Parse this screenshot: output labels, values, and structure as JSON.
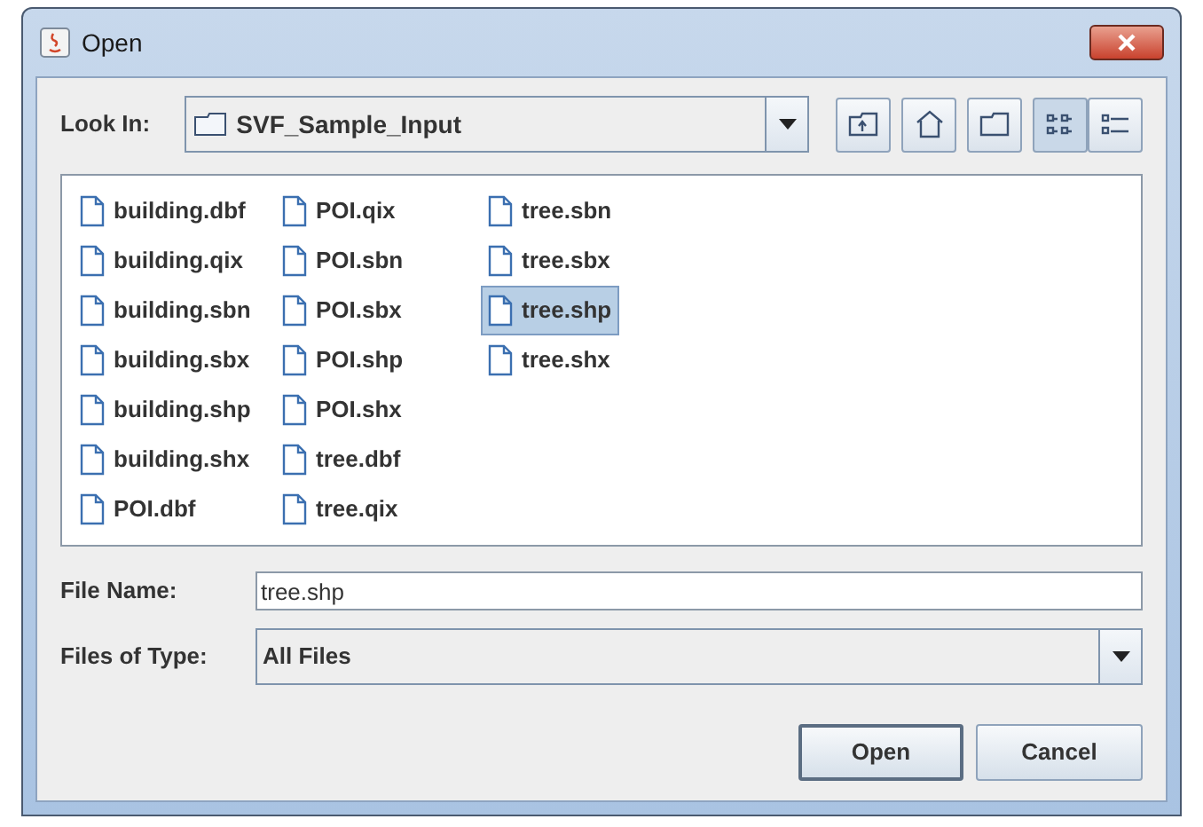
{
  "window": {
    "title": "Open"
  },
  "look_in": {
    "label": "Look In:",
    "value": "SVF_Sample_Input"
  },
  "toolbar": [
    {
      "kind": "up"
    },
    {
      "kind": "home"
    },
    {
      "kind": "new-folder"
    },
    {
      "kind": "list",
      "selected": true
    },
    {
      "kind": "details",
      "selected": false
    }
  ],
  "files": [
    {
      "name": "building.dbf",
      "selected": false
    },
    {
      "name": "building.qix",
      "selected": false
    },
    {
      "name": "building.sbn",
      "selected": false
    },
    {
      "name": "building.sbx",
      "selected": false
    },
    {
      "name": "building.shp",
      "selected": false
    },
    {
      "name": "building.shx",
      "selected": false
    },
    {
      "name": "POI.dbf",
      "selected": false
    },
    {
      "name": "POI.qix",
      "selected": false
    },
    {
      "name": "POI.sbn",
      "selected": false
    },
    {
      "name": "POI.sbx",
      "selected": false
    },
    {
      "name": "POI.shp",
      "selected": false
    },
    {
      "name": "POI.shx",
      "selected": false
    },
    {
      "name": "tree.dbf",
      "selected": false
    },
    {
      "name": "tree.qix",
      "selected": false
    },
    {
      "name": "tree.sbn",
      "selected": false
    },
    {
      "name": "tree.sbx",
      "selected": false
    },
    {
      "name": "tree.shp",
      "selected": true
    },
    {
      "name": "tree.shx",
      "selected": false
    }
  ],
  "file_name": {
    "label": "File Name:",
    "value": "tree.shp"
  },
  "files_of_type": {
    "label": "Files of Type:",
    "value": "All Files"
  },
  "buttons": [
    "Open",
    "Cancel"
  ]
}
